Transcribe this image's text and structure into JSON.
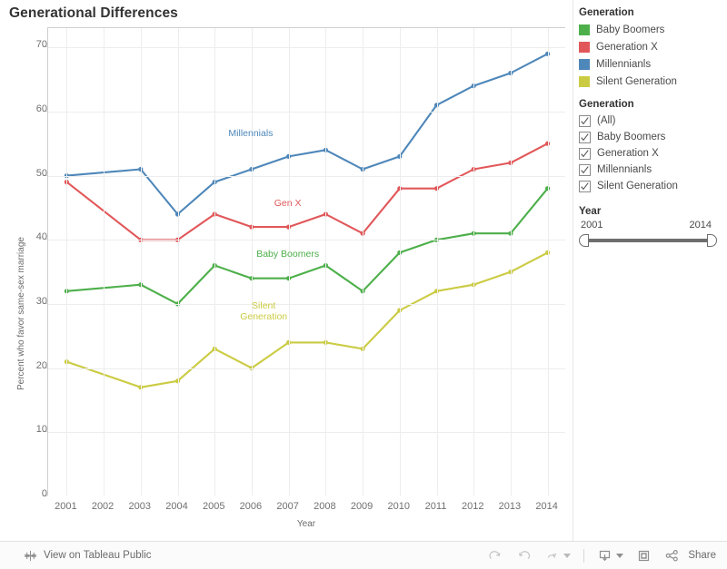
{
  "header": {
    "title": "Generational Differences"
  },
  "chart_data": {
    "type": "line",
    "title": "Generational Differences",
    "xlabel": "Year",
    "ylabel": "Percent who favor same-sex marriage",
    "x": [
      2001,
      2002,
      2003,
      2004,
      2005,
      2006,
      2007,
      2008,
      2009,
      2010,
      2011,
      2012,
      2013,
      2014
    ],
    "xticklabels": [
      "2001",
      "2002",
      "2003",
      "2004",
      "2005",
      "2006",
      "2007",
      "2008",
      "2009",
      "2010",
      "2011",
      "2012",
      "2013",
      "2014"
    ],
    "yticklabels": [
      "0",
      "10",
      "20",
      "30",
      "40",
      "50",
      "60",
      "70"
    ],
    "ylim": [
      0,
      73
    ],
    "yticks": [
      0,
      10,
      20,
      30,
      40,
      50,
      60,
      70
    ],
    "xlim": [
      2000.5,
      2014.5
    ],
    "grid": true,
    "legend_position": "right",
    "series": [
      {
        "name": "Baby Boomers",
        "color": "#4daf4a",
        "label_text": "Baby Boomers",
        "label_x": 2007,
        "label_y": 37.6,
        "points": [
          {
            "x": 2001,
            "y": 32
          },
          {
            "x": 2003,
            "y": 33
          },
          {
            "x": 2004,
            "y": 30
          },
          {
            "x": 2005,
            "y": 36
          },
          {
            "x": 2006,
            "y": 34
          },
          {
            "x": 2007,
            "y": 34
          },
          {
            "x": 2008,
            "y": 36
          },
          {
            "x": 2009,
            "y": 32
          },
          {
            "x": 2010,
            "y": 38
          },
          {
            "x": 2011,
            "y": 40
          },
          {
            "x": 2012,
            "y": 41
          },
          {
            "x": 2013,
            "y": 41
          },
          {
            "x": 2014,
            "y": 48
          }
        ]
      },
      {
        "name": "Generation X",
        "color": "#e15759",
        "label_text": "Gen X",
        "label_x": 2007,
        "label_y": 45.6,
        "points": [
          {
            "x": 2001,
            "y": 49
          },
          {
            "x": 2003,
            "y": 40
          },
          {
            "x": 2004,
            "y": 40
          },
          {
            "x": 2005,
            "y": 44
          },
          {
            "x": 2006,
            "y": 42
          },
          {
            "x": 2007,
            "y": 42
          },
          {
            "x": 2008,
            "y": 44
          },
          {
            "x": 2009,
            "y": 41
          },
          {
            "x": 2010,
            "y": 48
          },
          {
            "x": 2011,
            "y": 48
          },
          {
            "x": 2012,
            "y": 51
          },
          {
            "x": 2013,
            "y": 52
          },
          {
            "x": 2014,
            "y": 55
          }
        ]
      },
      {
        "name": "Millennianls",
        "color": "#4e87b9",
        "label_text": "Millennials",
        "label_x": 2006,
        "label_y": 56.4,
        "points": [
          {
            "x": 2001,
            "y": 50
          },
          {
            "x": 2003,
            "y": 51
          },
          {
            "x": 2004,
            "y": 44
          },
          {
            "x": 2005,
            "y": 49
          },
          {
            "x": 2006,
            "y": 51
          },
          {
            "x": 2007,
            "y": 53
          },
          {
            "x": 2008,
            "y": 54
          },
          {
            "x": 2009,
            "y": 51
          },
          {
            "x": 2010,
            "y": 53
          },
          {
            "x": 2011,
            "y": 61
          },
          {
            "x": 2012,
            "y": 64
          },
          {
            "x": 2013,
            "y": 66
          },
          {
            "x": 2014,
            "y": 69
          }
        ]
      },
      {
        "name": "Silent Generation",
        "color": "#cbcb43",
        "label_text": "Silent\nGeneration",
        "label_x": 2006.35,
        "label_y": 29.6,
        "points": [
          {
            "x": 2001,
            "y": 21
          },
          {
            "x": 2003,
            "y": 17
          },
          {
            "x": 2004,
            "y": 18
          },
          {
            "x": 2005,
            "y": 23
          },
          {
            "x": 2006,
            "y": 20
          },
          {
            "x": 2007,
            "y": 24
          },
          {
            "x": 2008,
            "y": 24
          },
          {
            "x": 2009,
            "y": 23
          },
          {
            "x": 2010,
            "y": 29
          },
          {
            "x": 2011,
            "y": 32
          },
          {
            "x": 2012,
            "y": 33
          },
          {
            "x": 2013,
            "y": 35
          },
          {
            "x": 2014,
            "y": 38
          }
        ]
      }
    ]
  },
  "legend": {
    "title": "Generation",
    "items": [
      {
        "label": "Baby Boomers",
        "color": "#4daf4a"
      },
      {
        "label": "Generation X",
        "color": "#e15759"
      },
      {
        "label": "Millennianls",
        "color": "#4e87b9"
      },
      {
        "label": "Silent Generation",
        "color": "#cbcb43"
      }
    ]
  },
  "generation_filter": {
    "title": "Generation",
    "options": [
      {
        "label": "(All)",
        "checked": true
      },
      {
        "label": "Baby Boomers",
        "checked": true
      },
      {
        "label": "Generation X",
        "checked": true
      },
      {
        "label": "Millennianls",
        "checked": true
      },
      {
        "label": "Silent Generation",
        "checked": true
      }
    ]
  },
  "year_filter": {
    "title": "Year",
    "min_label": "2001",
    "max_label": "2014"
  },
  "toolbar": {
    "tableau_public_label": "View on Tableau Public",
    "tableau_logo_icon": "tableau-snowflake-icon",
    "redo_icon": "redo-icon",
    "undo_icon": "undo-icon",
    "revert_icon": "revert-icon",
    "revert_caret_icon": "chevron-down-icon",
    "download_icon": "download-icon",
    "download_caret_icon": "chevron-down-icon",
    "fullscreen_icon": "fullscreen-icon",
    "share_icon": "share-icon",
    "share_label": "Share"
  }
}
